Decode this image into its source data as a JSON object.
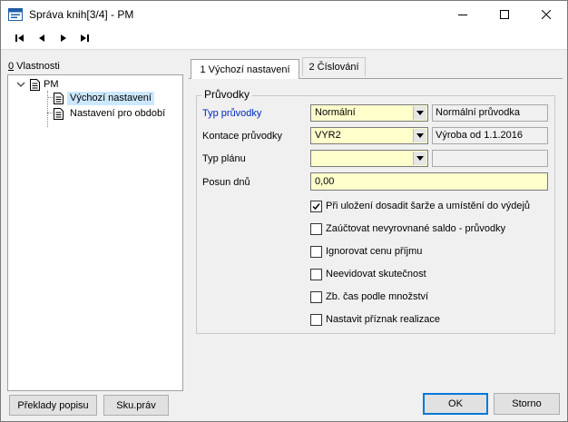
{
  "window": {
    "title": "Správa knih[3/4] - PM"
  },
  "toolbar": {
    "first_icon": "first-record-icon",
    "prev_icon": "previous-record-icon",
    "next_icon": "next-record-icon",
    "last_icon": "last-record-icon"
  },
  "left": {
    "label_key": "0",
    "label_rest": " Vlastnosti",
    "tree": {
      "root": "PM",
      "children": [
        "Výchozí nastavení",
        "Nastavení pro období"
      ]
    },
    "buttons": {
      "translations": "Překlady popisu",
      "rights": "Sku.práv"
    }
  },
  "tabs": [
    {
      "label": "1 Výchozí nastavení",
      "active": true
    },
    {
      "label": "2 Číslování",
      "active": false
    }
  ],
  "group": {
    "title": "Průvodky",
    "fields": {
      "typ_pruvodky": {
        "label": "Typ průvodky",
        "value": "Normální",
        "description": "Normální průvodka"
      },
      "kontace": {
        "label": "Kontace průvodky",
        "value": "VYR2",
        "description": "Výroba od 1.1.2016"
      },
      "typ_planu": {
        "label": "Typ plánu",
        "value": "",
        "description": ""
      },
      "posun": {
        "label": "Posun dnů",
        "value": "0,00"
      }
    },
    "checkboxes": [
      {
        "label": "Při uložení dosadit šarže a umístění do výdejů",
        "checked": true
      },
      {
        "label": "Zaúčtovat nevyrovnané saldo - průvodky",
        "checked": false
      },
      {
        "label": "Ignorovat cenu příjmu",
        "checked": false
      },
      {
        "label": "Neevidovat skutečnost",
        "checked": false
      },
      {
        "label": "Zb. čas podle množství",
        "checked": false
      },
      {
        "label": "Nastavit příznak realizace",
        "checked": false
      }
    ]
  },
  "footer": {
    "ok": "OK",
    "cancel": "Storno"
  },
  "colors": {
    "mandatory_field": "#ffffcc",
    "link_label": "#0026c0",
    "selection": "#cce8ff"
  }
}
